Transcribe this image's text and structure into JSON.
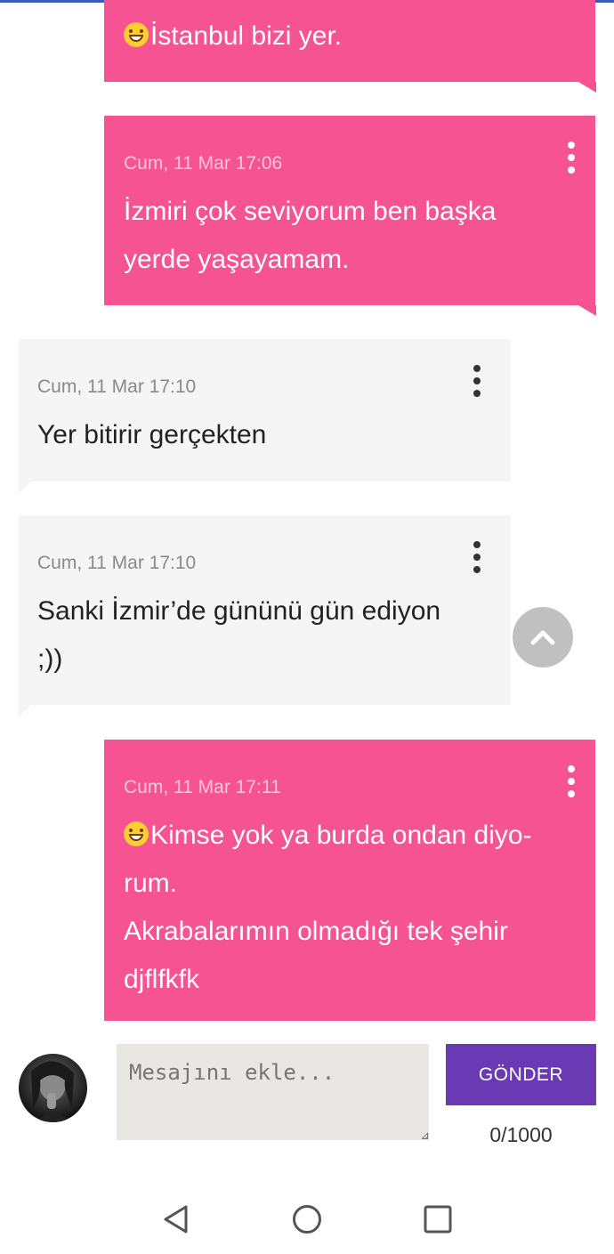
{
  "messages": [
    {
      "dir": "out",
      "time": "",
      "text": "İstanbul bizi yer.",
      "emoji": "grinning-emoji"
    },
    {
      "dir": "out",
      "time": "Cum, 11 Mar 17:06",
      "text": "İzmiri çok seviyorum ben başka\nyerde yaşayamam."
    },
    {
      "dir": "in",
      "time": "Cum, 11 Mar 17:10",
      "text": "Yer bitirir gerçekten"
    },
    {
      "dir": "in",
      "time": "Cum, 11 Mar 17:10",
      "text": "Sanki İzmir’de gününü gün ediyon\n;))"
    },
    {
      "dir": "out",
      "time": "Cum, 11 Mar 17:11",
      "text": "Kimse yok ya burda ondan diyo-\nrum.\nAkrabalarımın olmadığı tek şehir\ndjflfkfk",
      "emoji": "grinning-emoji"
    }
  ],
  "composer": {
    "placeholder": "Mesajını ekle...",
    "send_label": "GÖNDER",
    "counter": "0/1000"
  },
  "icons": {
    "scroll_top": "chevron-up-icon",
    "nav_back": "back-triangle-icon",
    "nav_home": "home-circle-icon",
    "nav_recents": "recents-square-icon",
    "more": "kebab-menu-icon"
  },
  "colors": {
    "outgoing_bubble": "#f55391",
    "incoming_bubble": "#f5f5f5",
    "send_button": "#6a3ab5"
  }
}
